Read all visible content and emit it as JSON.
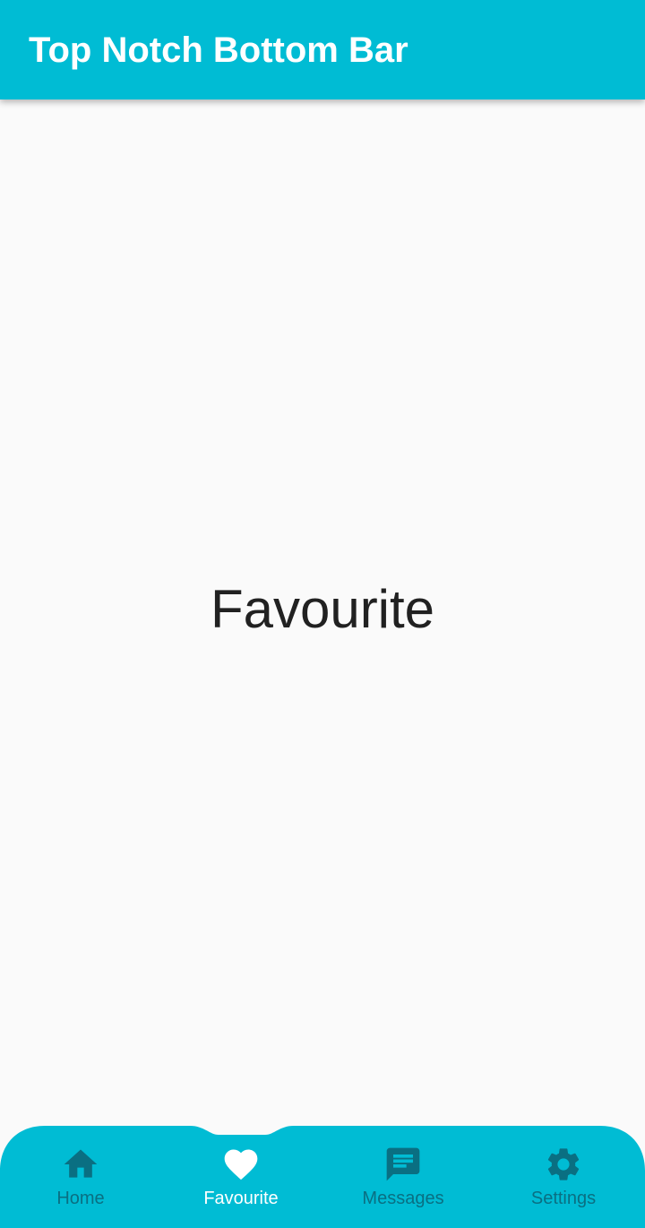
{
  "app_bar": {
    "title": "Top Notch Bottom Bar"
  },
  "content": {
    "text": "Favourite"
  },
  "bottom_nav": {
    "selected": "Favourite",
    "items": [
      {
        "label": "Home",
        "icon": "home-icon"
      },
      {
        "label": "Favourite",
        "icon": "heart-icon"
      },
      {
        "label": "Messages",
        "icon": "message-icon"
      },
      {
        "label": "Settings",
        "icon": "gear-icon"
      }
    ]
  },
  "colors": {
    "primary": "#00bcd4",
    "inactive_item": "#0a6f82",
    "active_item": "#ffffff",
    "background": "#fafafa",
    "content_text": "#212121"
  }
}
